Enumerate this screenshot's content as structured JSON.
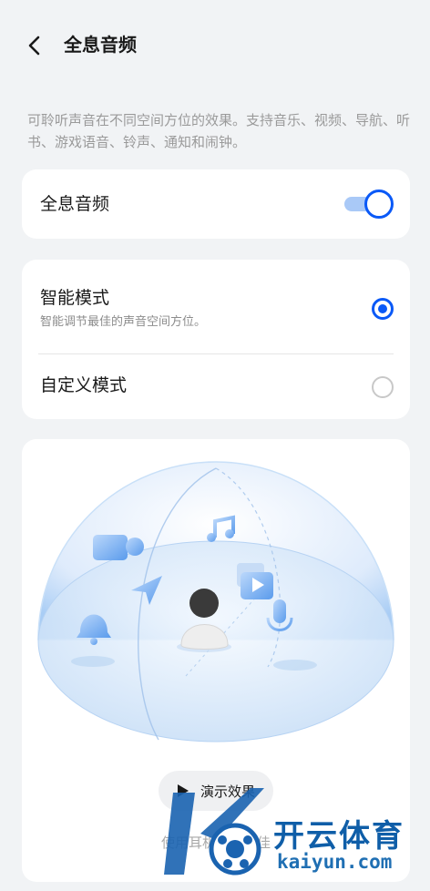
{
  "header": {
    "title": "全息音频"
  },
  "description": "可聆听声音在不同空间方位的效果。支持音乐、视频、导航、听书、游戏语音、铃声、通知和闹钟。",
  "audio_card": {
    "label": "全息音频",
    "enabled": true
  },
  "modes": [
    {
      "label": "智能模式",
      "sublabel": "智能调节最佳的声音空间方位。",
      "selected": true
    },
    {
      "label": "自定义模式",
      "selected": false
    }
  ],
  "demo": {
    "button_label": "演示效果",
    "hint": "使用耳机体验最佳"
  },
  "watermark": {
    "brand_cn": "开云体育",
    "brand_en": "kaiyun.com"
  },
  "colors": {
    "accent": "#0a59f7",
    "background": "#f1f3f5",
    "card": "#ffffff"
  }
}
